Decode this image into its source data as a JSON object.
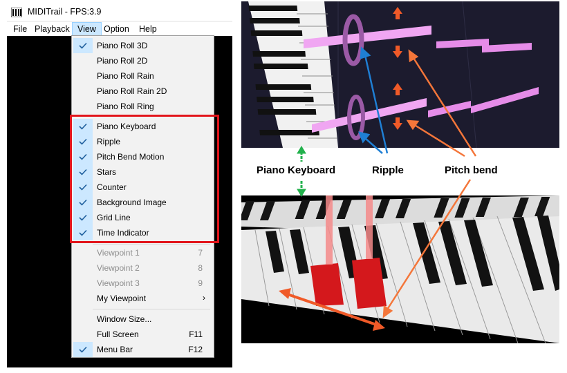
{
  "window": {
    "title": "MIDITrail - FPS:3.9"
  },
  "menubar": {
    "items": [
      "File",
      "Playback",
      "View",
      "Option",
      "Help"
    ],
    "active": "View"
  },
  "view_menu": {
    "piano_roll_3d": {
      "label": "Piano Roll 3D",
      "checked": true
    },
    "piano_roll_2d": {
      "label": "Piano Roll 2D",
      "checked": false
    },
    "piano_roll_rain": {
      "label": "Piano Roll Rain",
      "checked": false
    },
    "piano_roll_rain_2d": {
      "label": "Piano Roll Rain 2D",
      "checked": false
    },
    "piano_roll_ring": {
      "label": "Piano Roll Ring",
      "checked": false
    },
    "piano_keyboard": {
      "label": "Piano Keyboard",
      "checked": true
    },
    "ripple": {
      "label": "Ripple",
      "checked": true
    },
    "pitch_bend_motion": {
      "label": "Pitch Bend Motion",
      "checked": true
    },
    "stars": {
      "label": "Stars",
      "checked": true
    },
    "counter": {
      "label": "Counter",
      "checked": true
    },
    "background_image": {
      "label": "Background Image",
      "checked": true
    },
    "grid_line": {
      "label": "Grid Line",
      "checked": true
    },
    "time_indicator": {
      "label": "Time Indicator",
      "checked": true
    },
    "viewpoint_1": {
      "label": "Viewpoint 1",
      "shortcut": "7",
      "disabled": true
    },
    "viewpoint_2": {
      "label": "Viewpoint 2",
      "shortcut": "8",
      "disabled": true
    },
    "viewpoint_3": {
      "label": "Viewpoint 3",
      "shortcut": "9",
      "disabled": true
    },
    "my_viewpoint": {
      "label": "My Viewpoint",
      "submenu_glyph": "›"
    },
    "window_size": {
      "label": "Window Size..."
    },
    "full_screen": {
      "label": "Full Screen",
      "shortcut": "F11"
    },
    "menu_bar": {
      "label": "Menu Bar",
      "shortcut": "F12",
      "checked": true
    }
  },
  "annotations": {
    "piano_keyboard": "Piano Keyboard",
    "ripple": "Ripple",
    "pitch_bend": "Pitch bend"
  },
  "colors": {
    "highlight_box": "#e2151b",
    "arrow_green": "#22b14c",
    "arrow_blue": "#1f7fd4",
    "arrow_orange": "#f4763a",
    "note_bar": "#e58ce8",
    "pressed_key": "#d4181c"
  },
  "icons": [
    "app-icon",
    "check-icon",
    "chevron-right-icon"
  ]
}
